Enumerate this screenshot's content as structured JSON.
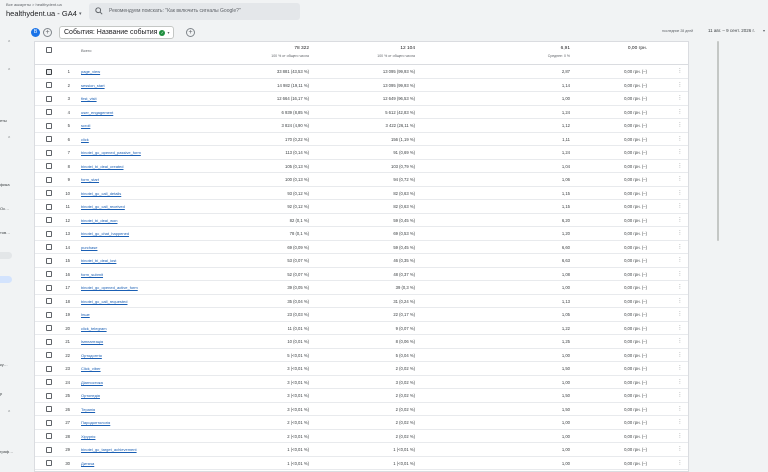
{
  "account": {
    "breadcrumb": "Все аккаунты > healthydent.ua",
    "property": "healthydent.ua - GA4"
  },
  "search": {
    "placeholder": "Рекомендуем поискать: \"Как включить сигналы Google?\""
  },
  "sidebar": {
    "fragments": [
      "еты",
      "фика",
      "Ос…",
      "тов…",
      "ку…",
      "р",
      "граф…"
    ]
  },
  "toolbar": {
    "badge": "B",
    "dimension_label": "События: Название события",
    "date_compare": "последние 28 дней",
    "date_range": "11 авг. – 9 сент. 2026 г."
  },
  "table": {
    "total_label": "Всего",
    "totals": {
      "events": "78 322",
      "events_sub": "100 % от общего числа",
      "users": "12 104",
      "users_sub": "100 % от общего числа",
      "per_user": "6,91",
      "per_user_sub": "Среднее: 0 %",
      "revenue": "0,00 грн.",
      "revenue_sub": ""
    },
    "rows": [
      {
        "idx": "1",
        "name": "page_view",
        "events": "33 881 (43,53 %)",
        "users": "13 095 (99,93 %)",
        "per": "2,87",
        "rev": "0,00 грн. (–)"
      },
      {
        "idx": "2",
        "name": "session_start",
        "events": "14 982 (19,11 %)",
        "users": "13 095 (99,93 %)",
        "per": "1,14",
        "rev": "0,00 грн. (–)"
      },
      {
        "idx": "3",
        "name": "first_visit",
        "events": "12 664 (16,17 %)",
        "users": "12 649 (96,53 %)",
        "per": "1,00",
        "rev": "0,00 грн. (–)"
      },
      {
        "idx": "4",
        "name": "user_engagement",
        "events": "6 939 (8,85 %)",
        "users": "5 612 (42,83 %)",
        "per": "1,24",
        "rev": "0,00 грн. (–)"
      },
      {
        "idx": "5",
        "name": "scroll",
        "events": "3 824 (4,90 %)",
        "users": "3 422 (26,11 %)",
        "per": "1,12",
        "rev": "0,00 грн. (–)"
      },
      {
        "idx": "6",
        "name": "click",
        "events": "170 (0,22 %)",
        "users": "156 (1,19 %)",
        "per": "1,11",
        "rev": "0,00 грн. (–)"
      },
      {
        "idx": "7",
        "name": "binotel_gc_opened_passive_form",
        "events": "113 (0,14 %)",
        "users": "91 (0,69 %)",
        "per": "1,24",
        "rev": "0,00 грн. (–)"
      },
      {
        "idx": "8",
        "name": "binotel_bi_deal_created",
        "events": "105 (0,13 %)",
        "users": "103 (0,79 %)",
        "per": "1,04",
        "rev": "0,00 грн. (–)"
      },
      {
        "idx": "9",
        "name": "form_start",
        "events": "100 (0,13 %)",
        "users": "94 (0,72 %)",
        "per": "1,06",
        "rev": "0,00 грн. (–)"
      },
      {
        "idx": "10",
        "name": "binotel_gc_call_details",
        "events": "93 (0,12 %)",
        "users": "82 (0,63 %)",
        "per": "1,15",
        "rev": "0,00 грн. (–)"
      },
      {
        "idx": "11",
        "name": "binotel_gc_call_received",
        "events": "92 (0,12 %)",
        "users": "82 (0,63 %)",
        "per": "1,15",
        "rev": "0,00 грн. (–)"
      },
      {
        "idx": "12",
        "name": "binotel_bi_deal_won",
        "events": "82 (0,1 %)",
        "users": "59 (0,45 %)",
        "per": "6,20",
        "rev": "0,00 грн. (–)"
      },
      {
        "idx": "13",
        "name": "binotel_gc_chat_happened",
        "events": "78 (0,1 %)",
        "users": "69 (0,53 %)",
        "per": "1,20",
        "rev": "0,00 грн. (–)"
      },
      {
        "idx": "14",
        "name": "purchase",
        "events": "69 (0,09 %)",
        "users": "59 (0,45 %)",
        "per": "6,60",
        "rev": "0,00 грн. (–)"
      },
      {
        "idx": "15",
        "name": "binotel_bi_deal_lost",
        "events": "53 (0,07 %)",
        "users": "46 (0,35 %)",
        "per": "6,63",
        "rev": "0,00 грн. (–)"
      },
      {
        "idx": "16",
        "name": "form_submit",
        "events": "52 (0,07 %)",
        "users": "48 (0,37 %)",
        "per": "1,08",
        "rev": "0,00 грн. (–)"
      },
      {
        "idx": "17",
        "name": "binotel_gc_opened_active_form",
        "events": "39 (0,05 %)",
        "users": "39 (0,3 %)",
        "per": "1,00",
        "rev": "0,00 грн. (–)"
      },
      {
        "idx": "18",
        "name": "binotel_gc_call_requested",
        "events": "35 (0,04 %)",
        "users": "31 (0,24 %)",
        "per": "1,13",
        "rev": "0,00 грн. (–)"
      },
      {
        "idx": "19",
        "name": "Інше",
        "events": "23 (0,03 %)",
        "users": "22 (0,17 %)",
        "per": "1,05",
        "rev": "0,00 грн. (–)"
      },
      {
        "idx": "20",
        "name": "click_telegram",
        "events": "11 (0,01 %)",
        "users": "9 (0,07 %)",
        "per": "1,22",
        "rev": "0,00 грн. (–)"
      },
      {
        "idx": "21",
        "name": "Імплантація",
        "events": "10 (0,01 %)",
        "users": "8 (0,06 %)",
        "per": "1,25",
        "rev": "0,00 грн. (–)"
      },
      {
        "idx": "22",
        "name": "Ортодонтія",
        "events": "5 (<0,01 %)",
        "users": "5 (0,04 %)",
        "per": "1,00",
        "rev": "0,00 грн. (–)"
      },
      {
        "idx": "23",
        "name": "Click_viber",
        "events": "3 (<0,01 %)",
        "users": "2 (0,02 %)",
        "per": "1,50",
        "rev": "0,00 грн. (–)"
      },
      {
        "idx": "24",
        "name": "Діагностика",
        "events": "3 (<0,01 %)",
        "users": "3 (0,02 %)",
        "per": "1,00",
        "rev": "0,00 грн. (–)"
      },
      {
        "idx": "25",
        "name": "Ортопедія",
        "events": "3 (<0,01 %)",
        "users": "2 (0,02 %)",
        "per": "1,50",
        "rev": "0,00 грн. (–)"
      },
      {
        "idx": "26",
        "name": "Терапія",
        "events": "3 (<0,01 %)",
        "users": "2 (0,02 %)",
        "per": "1,50",
        "rev": "0,00 грн. (–)"
      },
      {
        "idx": "27",
        "name": "Пародонтологія",
        "events": "2 (<0,01 %)",
        "users": "2 (0,02 %)",
        "per": "1,00",
        "rev": "0,00 грн. (–)"
      },
      {
        "idx": "28",
        "name": "Хірургія",
        "events": "2 (<0,01 %)",
        "users": "2 (0,02 %)",
        "per": "1,00",
        "rev": "0,00 грн. (–)"
      },
      {
        "idx": "29",
        "name": "binotel_gc_target_achievement",
        "events": "1 (<0,01 %)",
        "users": "1 (<0,01 %)",
        "per": "1,00",
        "rev": "0,00 грн. (–)"
      },
      {
        "idx": "30",
        "name": "Дитяча",
        "events": "1 (<0,01 %)",
        "users": "1 (<0,01 %)",
        "per": "1,00",
        "rev": "0,00 грн. (–)"
      }
    ]
  },
  "colors": {
    "link": "#1a5fb4",
    "accent": "#1a73e8",
    "check": "#1e8e3e"
  }
}
